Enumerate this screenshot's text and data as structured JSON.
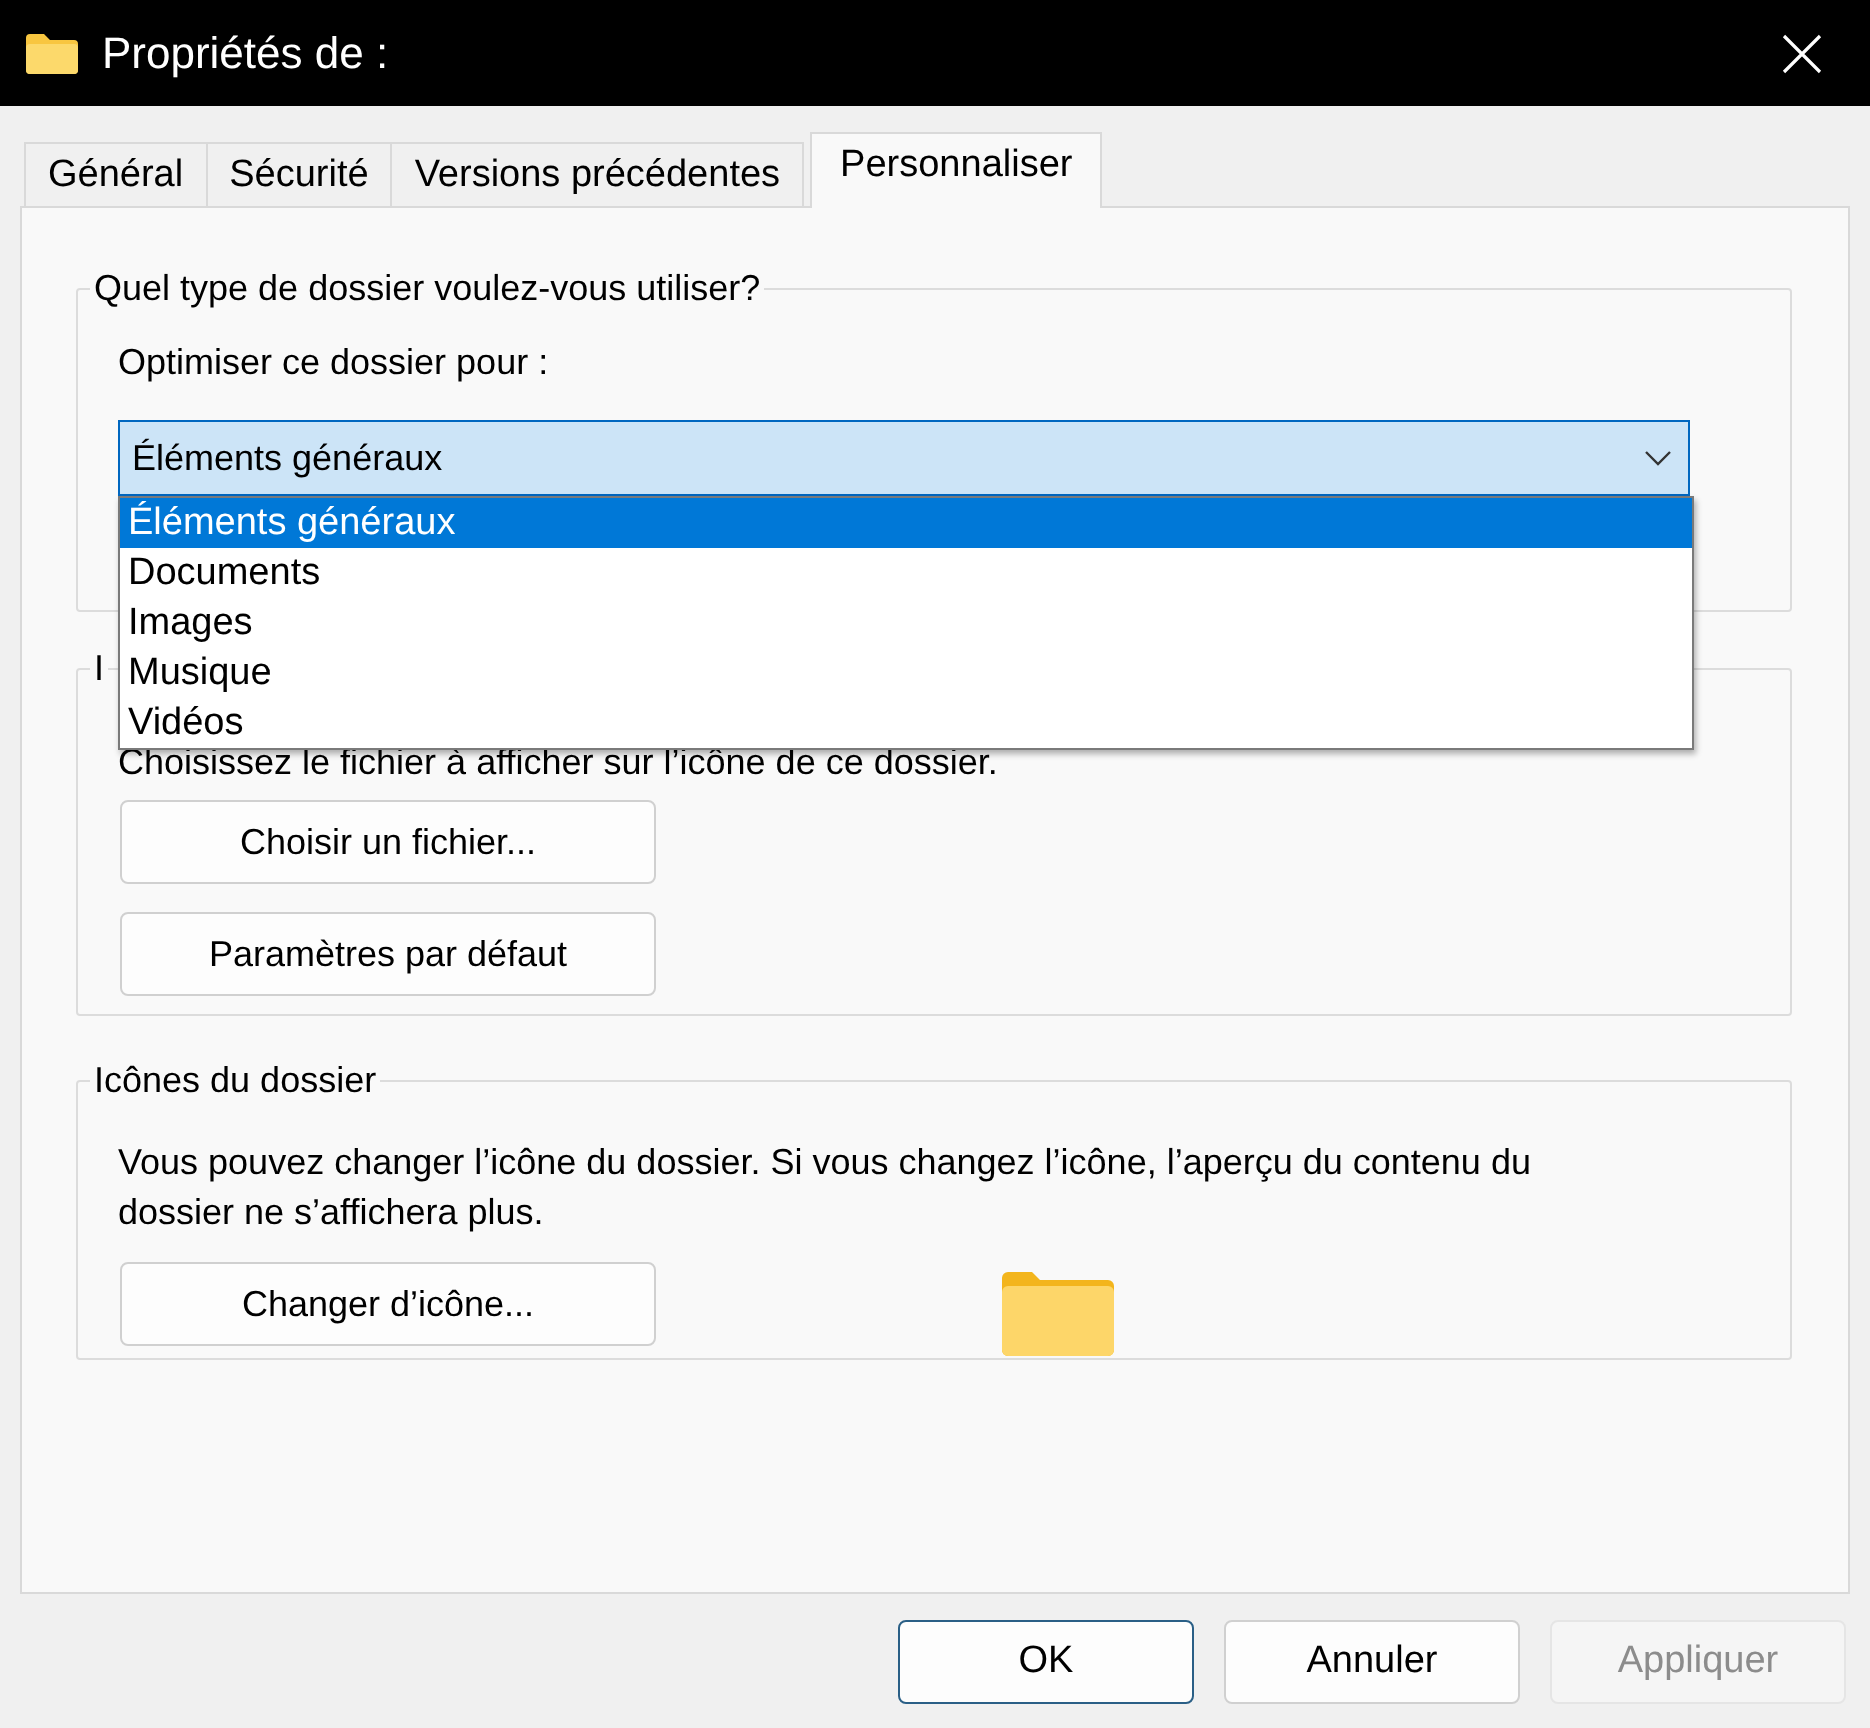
{
  "window": {
    "title": "Propriétés de :"
  },
  "tabs": [
    {
      "label": "Général",
      "selected": false
    },
    {
      "label": "Sécurité",
      "selected": false
    },
    {
      "label": "Versions précédentes",
      "selected": false
    },
    {
      "label": "Personnaliser",
      "selected": true
    }
  ],
  "folder_type": {
    "legend": "Quel type de dossier voulez-vous utiliser?",
    "label": "Optimiser ce dossier pour :",
    "value": "Éléments généraux",
    "expanded": true,
    "options": [
      {
        "label": "Éléments généraux",
        "selected": true
      },
      {
        "label": "Documents",
        "selected": false
      },
      {
        "label": "Images",
        "selected": false
      },
      {
        "label": "Musique",
        "selected": false
      },
      {
        "label": "Vidéos",
        "selected": false
      }
    ]
  },
  "folder_images": {
    "legend": "I",
    "description": "Choisissez le fichier à afficher sur l’icône de ce dossier.",
    "buttons": [
      "Choisir un fichier...",
      "Paramètres par défaut"
    ]
  },
  "folder_icons": {
    "legend": "Icônes du dossier",
    "description": "Vous pouvez changer l’icône du dossier. Si vous changez l’icône, l’aperçu du contenu du dossier ne s’affichera plus.",
    "button": "Changer d’icône..."
  },
  "buttons": [
    {
      "label": "OK",
      "default": true,
      "disabled": false
    },
    {
      "label": "Annuler",
      "default": false,
      "disabled": false
    },
    {
      "label": "Appliquer",
      "default": false,
      "disabled": true
    }
  ]
}
